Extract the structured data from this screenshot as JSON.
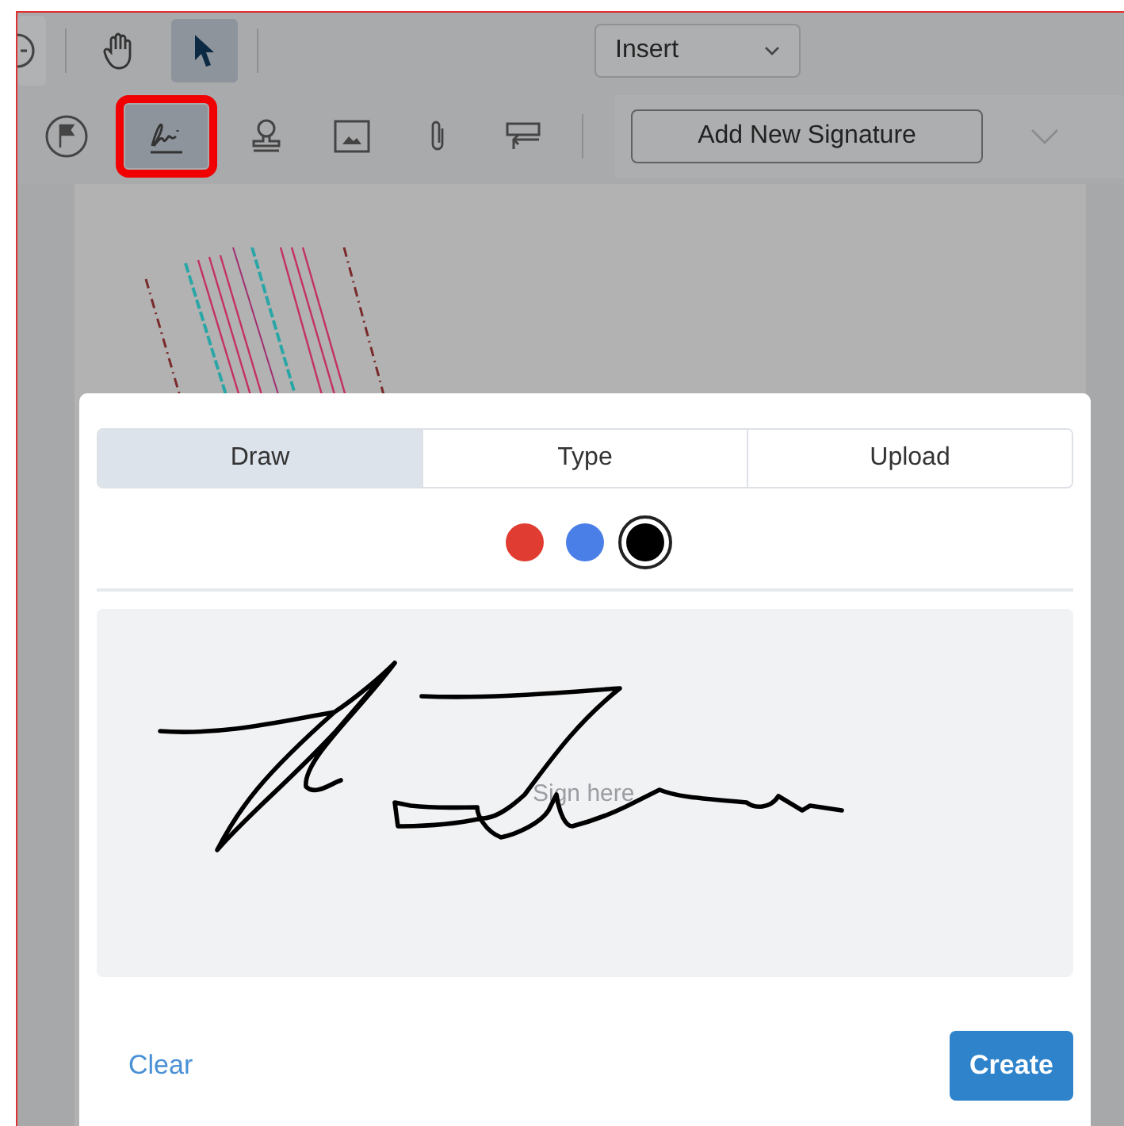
{
  "toolbar": {
    "mode_tools": [
      {
        "kind": "zoom",
        "selected": false
      },
      {
        "kind": "pan",
        "selected": false
      },
      {
        "kind": "select",
        "selected": true
      }
    ],
    "menu": {
      "value": "Insert"
    },
    "insert_tools": [
      {
        "kind": "flag",
        "selected": false,
        "highlighted": false
      },
      {
        "kind": "signature",
        "selected": true,
        "highlighted": true
      },
      {
        "kind": "stamp",
        "selected": false,
        "highlighted": false
      },
      {
        "kind": "image",
        "selected": false,
        "highlighted": false
      },
      {
        "kind": "attachment",
        "selected": false,
        "highlighted": false
      },
      {
        "kind": "form",
        "selected": false,
        "highlighted": false
      }
    ],
    "signature_button": "Add New Signature"
  },
  "dialog": {
    "tabs": [
      {
        "label": "Draw",
        "selected": true
      },
      {
        "label": "Type",
        "selected": false
      },
      {
        "label": "Upload",
        "selected": false
      }
    ],
    "colors": [
      {
        "color": "#e03c31",
        "selected": false
      },
      {
        "color": "#4a7fe8",
        "selected": false
      },
      {
        "color": "#000000",
        "selected": true
      }
    ],
    "canvas": {
      "placeholder": "Sign here"
    },
    "clear_button": "Clear",
    "create_button": "Create"
  }
}
